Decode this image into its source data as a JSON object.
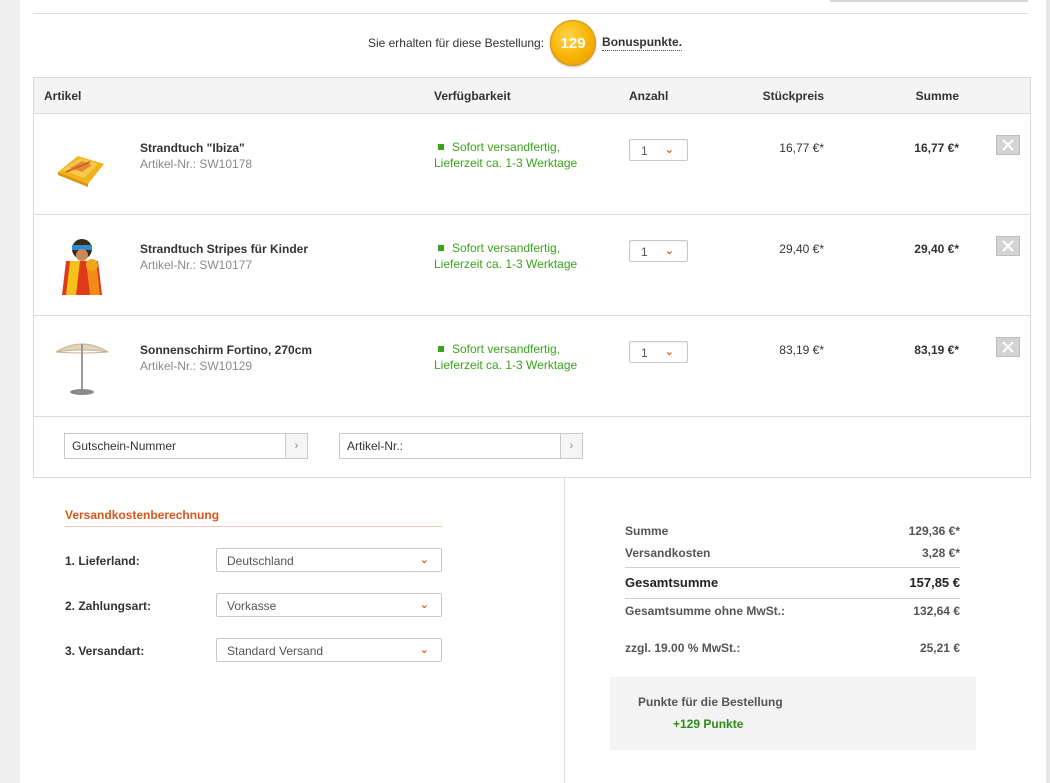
{
  "bonus": {
    "text": "Sie erhalten für diese Bestellung:",
    "points": "129",
    "link_label": "Bonuspunkte."
  },
  "cart": {
    "headers": {
      "article": "Artikel",
      "availability": "Verfügbarkeit",
      "quantity": "Anzahl",
      "unit_price": "Stückpreis",
      "sum": "Summe"
    },
    "items": [
      {
        "name": "Strandtuch \"Ibiza\"",
        "number": "Artikel-Nr.: SW10178",
        "availability_line1": "Sofort versandfertig,",
        "availability_line2": "Lieferzeit ca. 1-3 Werktage",
        "quantity": "1",
        "unit_price": "16,77 €*",
        "sum": "16,77 €*"
      },
      {
        "name": "Strandtuch Stripes für Kinder",
        "number": "Artikel-Nr.: SW10177",
        "availability_line1": "Sofort versandfertig,",
        "availability_line2": "Lieferzeit ca. 1-3 Werktage",
        "quantity": "1",
        "unit_price": "29,40 €*",
        "sum": "29,40 €*"
      },
      {
        "name": "Sonnenschirm Fortino, 270cm",
        "number": "Artikel-Nr.: SW10129",
        "availability_line1": "Sofort versandfertig,",
        "availability_line2": "Lieferzeit ca. 1-3 Werktage",
        "quantity": "1",
        "unit_price": "83,19 €*",
        "sum": "83,19 €*"
      }
    ],
    "voucher_placeholder": "Gutschein-Nummer",
    "article_no_placeholder": "Artikel-Nr.:"
  },
  "shipping": {
    "title": "Versandkostenberechnung",
    "country_label": "1. Lieferland:",
    "country_value": "Deutschland",
    "payment_label": "2. Zahlungsart:",
    "payment_value": "Vorkasse",
    "method_label": "3. Versandart:",
    "method_value": "Standard Versand"
  },
  "totals": {
    "sum_label": "Summe",
    "sum_value": "129,36 €*",
    "shipping_label": "Versandkosten",
    "shipping_value": "3,28 €*",
    "grand_label": "Gesamtsumme",
    "grand_value": "157,85 €",
    "net_label": "Gesamtsumme ohne MwSt.:",
    "net_value": "132,64 €",
    "vat_label": "zzgl. 19.00 % MwSt.:",
    "vat_value": "25,21 €"
  },
  "points": {
    "label": "Punkte für die Bestellung",
    "value": "+129 Punkte"
  },
  "colors": {
    "accent": "#e2520c",
    "available_green": "#3ba419",
    "coin": "#f7b200"
  }
}
